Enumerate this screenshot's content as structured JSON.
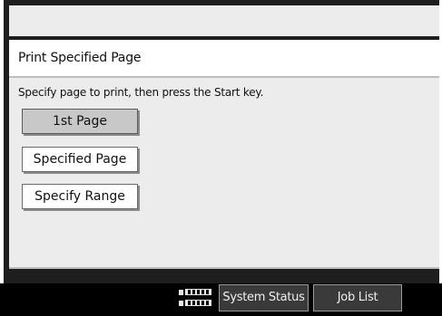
{
  "screen": {
    "title": "Print Specified Page",
    "instruction": "Specify page to print, then press the Start key.",
    "options": [
      {
        "label": "1st Page",
        "selected": true
      },
      {
        "label": "Specified Page",
        "selected": false
      },
      {
        "label": "Specify Range",
        "selected": false
      }
    ]
  },
  "status_bar": {
    "system_status_label": "System Status",
    "job_list_label": "Job List"
  },
  "colors": {
    "bezel": "#1e1e1e",
    "panel_background": "#ececec",
    "selected_button": "#c8c8c8",
    "status_bar": "#000000"
  }
}
